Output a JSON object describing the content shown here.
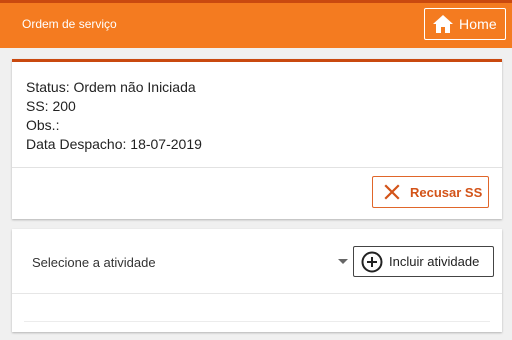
{
  "header": {
    "title": "Ordem de serviço",
    "home_label": "Home",
    "home_icon": "home-icon",
    "bar_color": "#f47b20"
  },
  "order": {
    "status": "Status: Ordem não Iniciada",
    "ss": "SS: 200",
    "obs": "Obs.:",
    "dispatch_date": "Data Despacho: 18-07-2019",
    "refuse_label": "Recusar SS",
    "refuse_icon": "close-icon",
    "accent_color": "#d35318"
  },
  "activity": {
    "select_value": "Selecione a atividade",
    "select_icon": "caret-down-icon",
    "include_label": "Incluir atividade",
    "include_icon": "plus-circle-icon"
  }
}
